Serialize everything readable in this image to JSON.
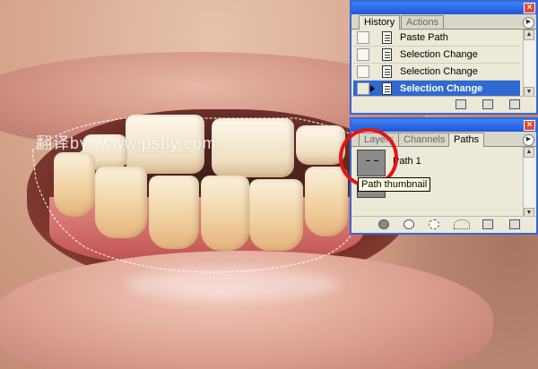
{
  "watermark": {
    "text": "翻译by: www.psfly.com"
  },
  "history_palette": {
    "tabs": [
      {
        "label": "History",
        "active": true
      },
      {
        "label": "Actions",
        "active": false
      }
    ],
    "rows": [
      {
        "label": "Paste Path",
        "selected": false
      },
      {
        "label": "Selection Change",
        "selected": false
      },
      {
        "label": "Selection Change",
        "selected": false
      },
      {
        "label": "Selection Change",
        "selected": true
      }
    ],
    "close_icon": "close-icon",
    "menu_icon": "palette-menu-icon"
  },
  "paths_palette": {
    "tabs": [
      {
        "label": "Layers",
        "active": false
      },
      {
        "label": "Channels",
        "active": false
      },
      {
        "label": "Paths",
        "active": true
      }
    ],
    "paths": [
      {
        "label": "Path 1"
      }
    ],
    "tooltip": "Path thumbnail",
    "bottom_icons": [
      "fill-path-icon",
      "stroke-path-icon",
      "load-selection-icon",
      "make-path-icon",
      "new-path-icon",
      "delete-path-icon"
    ]
  },
  "colors": {
    "titlebar": "#2156d8",
    "selection_row": "#2f6ad0",
    "annotation": "#e01616",
    "palette_bg": "#ece9d8"
  }
}
